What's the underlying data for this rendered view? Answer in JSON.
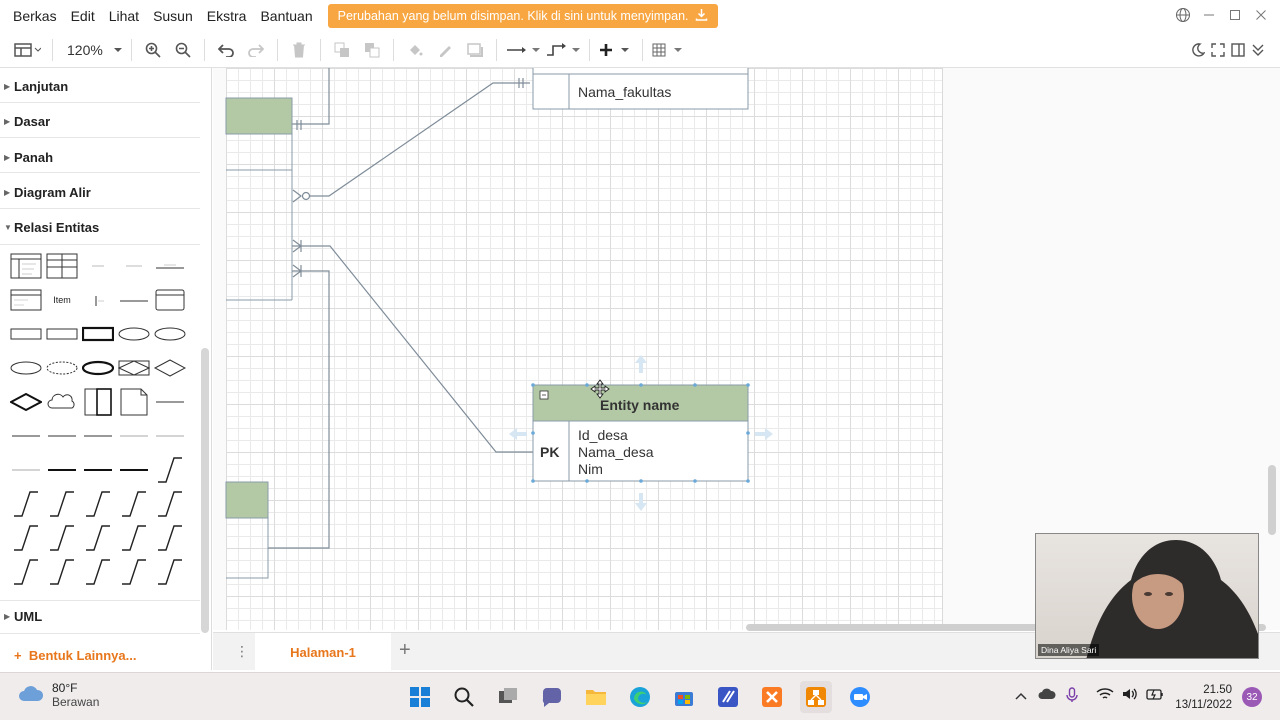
{
  "menubar": {
    "items": [
      "Berkas",
      "Edit",
      "Lihat",
      "Susun",
      "Ekstra",
      "Bantuan"
    ],
    "unsaved_notice": "Perubahan yang belum disimpan. Klik di sini untuk menyimpan.",
    "unsaved_icon": "download-icon",
    "window_icons": [
      "globe-icon",
      "minimize-icon",
      "maximize-icon",
      "close-icon"
    ]
  },
  "toolbar": {
    "zoom": "120%",
    "icons": [
      "format-panel-icon",
      "zoom-in-icon",
      "zoom-out-icon",
      "undo-icon",
      "redo-icon",
      "delete-icon",
      "to-front-icon",
      "to-back-icon",
      "fill-color-icon",
      "line-color-icon",
      "shadow-icon",
      "connection-icon",
      "waypoints-icon",
      "insert-icon",
      "table-icon"
    ],
    "right_icons": [
      "theme-icon",
      "fullscreen-icon",
      "panel-icon",
      "collapse-icon"
    ]
  },
  "sidebar": {
    "sections": [
      "Lanjutan",
      "Dasar",
      "Panah",
      "Diagram Alir",
      "Relasi Entitas"
    ],
    "shape_item_label": "Item",
    "uml": "UML",
    "more_shapes": "Bentuk Lainnya...",
    "more_icon": "plus-icon"
  },
  "diagram": {
    "top_entity_attr": "Nama_fakultas",
    "entity": {
      "title": "Entity name",
      "key": "PK",
      "attributes": [
        "Id_desa",
        "Nama_desa",
        "Nim"
      ]
    },
    "colors": {
      "entity_header": "#b3c9a6",
      "entity_border": "#8a9aa8",
      "connector": "#7f8c99"
    }
  },
  "pages": {
    "tab": "Halaman-1",
    "add_icon": "plus-icon"
  },
  "webcam": {
    "name": "Dina Aliya Sari"
  },
  "taskbar": {
    "weather_temp": "80°F",
    "weather_cond": "Berawan",
    "time": "21.50",
    "date": "13/11/2022",
    "notifications": "32",
    "apps": [
      "windows-start-icon",
      "search-icon",
      "task-view-icon",
      "chat-icon",
      "file-explorer-icon",
      "edge-icon",
      "store-icon",
      "vscode-icon",
      "xampp-icon",
      "drawio-icon",
      "zoom-icon"
    ],
    "tray_icons": [
      "chevron-up-icon",
      "onedrive-icon",
      "mic-icon",
      "wifi-icon",
      "volume-icon",
      "battery-icon"
    ]
  }
}
